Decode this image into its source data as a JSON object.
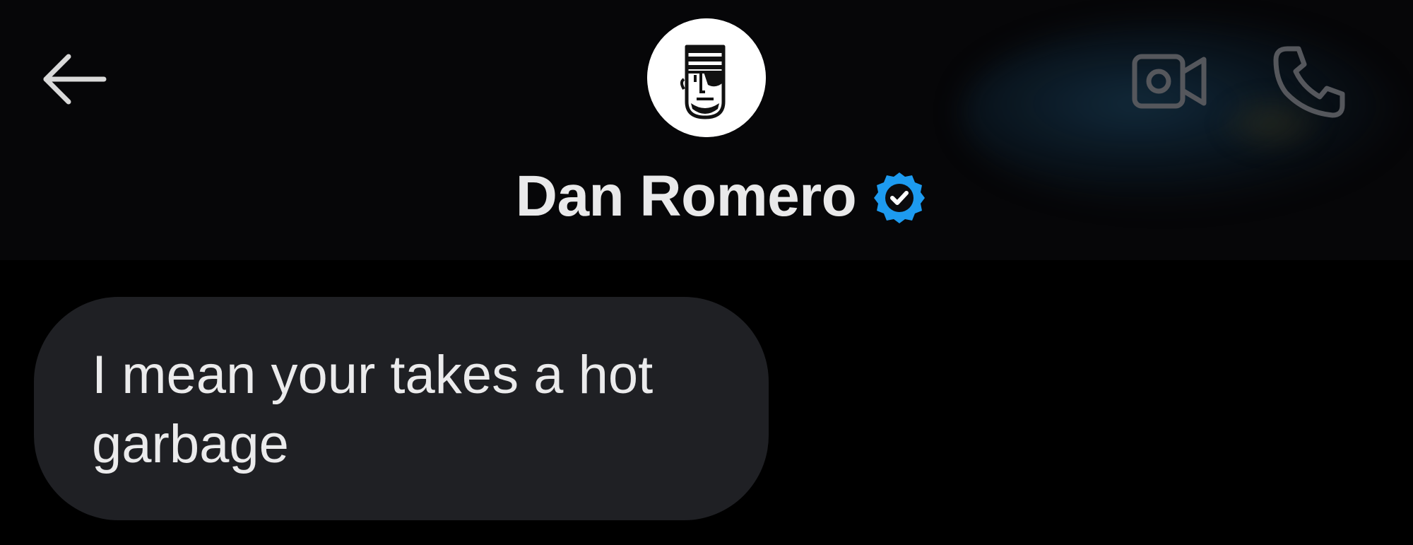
{
  "header": {
    "contact_name": "Dan Romero",
    "verified": true,
    "back_icon": "arrow-left-icon",
    "video_icon": "video-camera-icon",
    "call_icon": "phone-icon",
    "avatar_icon": "pirate-face-avatar"
  },
  "messages": [
    {
      "direction": "incoming",
      "text": "I mean your takes a hot garbage"
    }
  ],
  "colors": {
    "background": "#000000",
    "header_background": "#060608",
    "bubble_incoming": "#1f2024",
    "text_primary": "#ebebec",
    "verified_blue": "#1d9bf0",
    "icon_muted": "#55575c",
    "icon_bright": "#d9d9d9"
  }
}
